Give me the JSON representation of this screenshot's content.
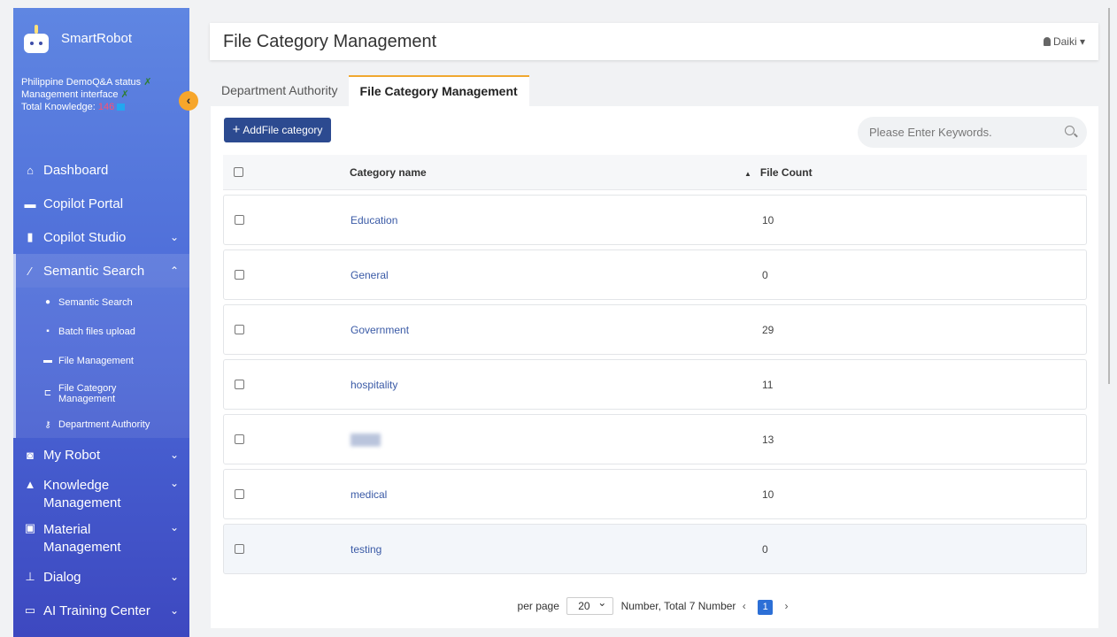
{
  "brand": {
    "name": "SmartRobot"
  },
  "status": {
    "line1": "Philippine DemoQ&A status",
    "line2": "Management interface",
    "line3_label": "Total Knowledge:",
    "line3_value": "146"
  },
  "sidebar": {
    "items": [
      {
        "label": "Dashboard",
        "icon": "home-icon"
      },
      {
        "label": "Copilot Portal",
        "icon": "car-icon"
      },
      {
        "label": "Copilot Studio",
        "icon": "gas-pump-icon"
      },
      {
        "label": "Semantic Search",
        "icon": "magic-wand-icon"
      },
      {
        "label": "My Robot",
        "icon": "robot-icon"
      },
      {
        "label": "Knowledge Management",
        "label_l1": "Knowledge",
        "label_l2": "Management",
        "icon": "graduation-cap-icon"
      },
      {
        "label": "Material Management",
        "label_l1": "Material",
        "label_l2": "Management",
        "icon": "images-icon"
      },
      {
        "label": "Dialog",
        "icon": "sitemap-icon"
      },
      {
        "label": "AI Training Center",
        "icon": "laptop-icon"
      }
    ],
    "sub_items": [
      {
        "label": "Semantic Search",
        "icon": "chat-bubbles-icon"
      },
      {
        "label": "Batch files upload",
        "icon": "file-icon"
      },
      {
        "label": "File Management",
        "icon": "folder-icon"
      },
      {
        "label": "File Category Management",
        "label_l1": "File Category",
        "label_l2": "Management",
        "icon": "tree-icon"
      },
      {
        "label": "Department Authority",
        "icon": "key-icon"
      }
    ]
  },
  "header": {
    "title": "File Category Management",
    "user": "Daiki"
  },
  "tabs": [
    {
      "label": "Department Authority",
      "active": false
    },
    {
      "label": "File Category Management",
      "active": true
    }
  ],
  "toolbar": {
    "add_label": "AddFile category"
  },
  "search": {
    "placeholder": "Please Enter Keywords."
  },
  "table": {
    "headers": {
      "name": "Category name",
      "count": "File Count"
    },
    "rows": [
      {
        "name": "Education",
        "count": "10"
      },
      {
        "name": "General",
        "count": "0"
      },
      {
        "name": "Government",
        "count": "29"
      },
      {
        "name": "hospitality",
        "count": "11"
      },
      {
        "name": "",
        "count": "13"
      },
      {
        "name": "medical",
        "count": "10"
      },
      {
        "name": "testing",
        "count": "0"
      }
    ]
  },
  "pagination": {
    "per_page_label": "per page",
    "per_page_value": "20",
    "summary": "Number, Total 7 Number",
    "current_page": "1"
  },
  "colors": {
    "accent": "#2c4a90",
    "tab_active_border": "#f0a830",
    "sidebar_top": "#5f86e2",
    "sidebar_bottom": "#3d48c0",
    "link": "#3a5aa6"
  }
}
